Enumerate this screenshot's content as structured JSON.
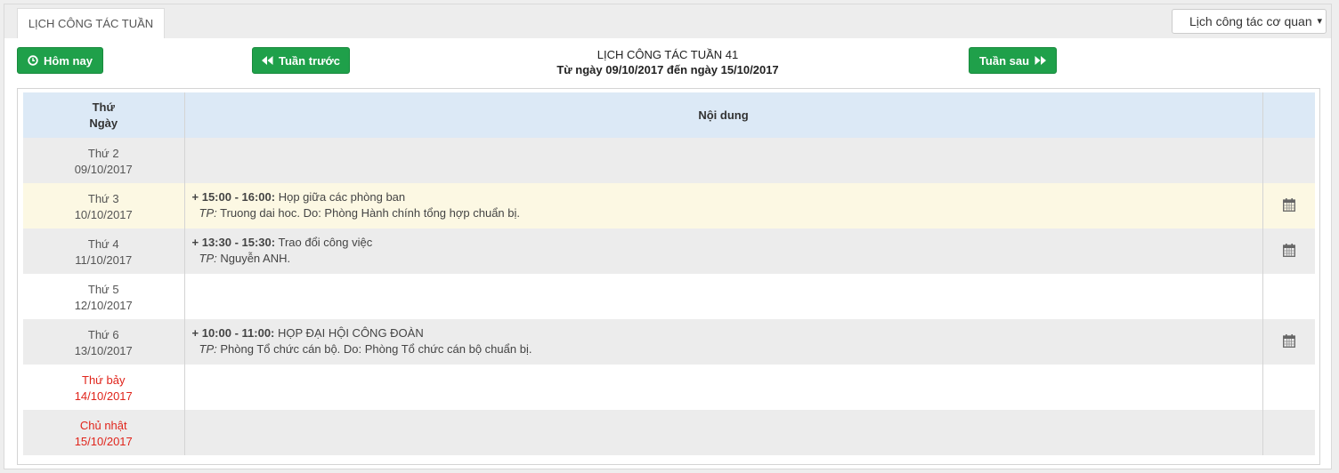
{
  "tab": {
    "label": "LỊCH CÔNG TÁC TUẦN"
  },
  "calendar_select": {
    "value": "Lịch công tác cơ quan",
    "caret": "▾"
  },
  "buttons": {
    "today": "Hôm nay",
    "prev": "Tuần trước",
    "next": "Tuần sau"
  },
  "week": {
    "title": "LỊCH CÔNG TÁC TUẦN 41",
    "range": "Từ ngày 09/10/2017 đến ngày 15/10/2017"
  },
  "table": {
    "header_day_line1": "Thứ",
    "header_day_line2": "Ngày",
    "header_content": "Nội dung"
  },
  "days": [
    {
      "name": "Thứ 2",
      "date": "09/10/2017"
    },
    {
      "name": "Thứ 3",
      "date": "10/10/2017"
    },
    {
      "name": "Thứ 4",
      "date": "11/10/2017"
    },
    {
      "name": "Thứ 5",
      "date": "12/10/2017"
    },
    {
      "name": "Thứ 6",
      "date": "13/10/2017"
    },
    {
      "name": "Thứ bảy",
      "date": "14/10/2017"
    },
    {
      "name": "Chủ nhật",
      "date": "15/10/2017"
    }
  ],
  "events": [
    {
      "prefix": "+ ",
      "time": "15:00 - 16:00:",
      "title": " Họp giữa các phòng ban",
      "tp_label": "TP:",
      "detail": " Truong dai hoc. Do: Phòng Hành chính tổng hợp chuẩn bị."
    },
    {
      "prefix": "+ ",
      "time": "13:30 - 15:30:",
      "title": " Trao đổi công việc",
      "tp_label": "TP:",
      "detail": " Nguyễn ANH."
    },
    {
      "prefix": "+ ",
      "time": "10:00 - 11:00:",
      "title": " HỌP ĐẠI HỘI CÔNG ĐOÀN",
      "tp_label": "TP:",
      "detail": " Phòng Tổ chức cán bộ. Do: Phòng Tổ chức cán bộ chuẩn bị."
    }
  ],
  "colors": {
    "accent_green": "#1fa04a",
    "header_blue": "#dce9f6",
    "highlight_yellow": "#fcf8e3",
    "weekend_red": "#e0241b"
  },
  "icons": {
    "today": "clock-icon",
    "prev": "double-left-icon",
    "next": "double-right-icon",
    "calendar": "calendar-icon"
  }
}
